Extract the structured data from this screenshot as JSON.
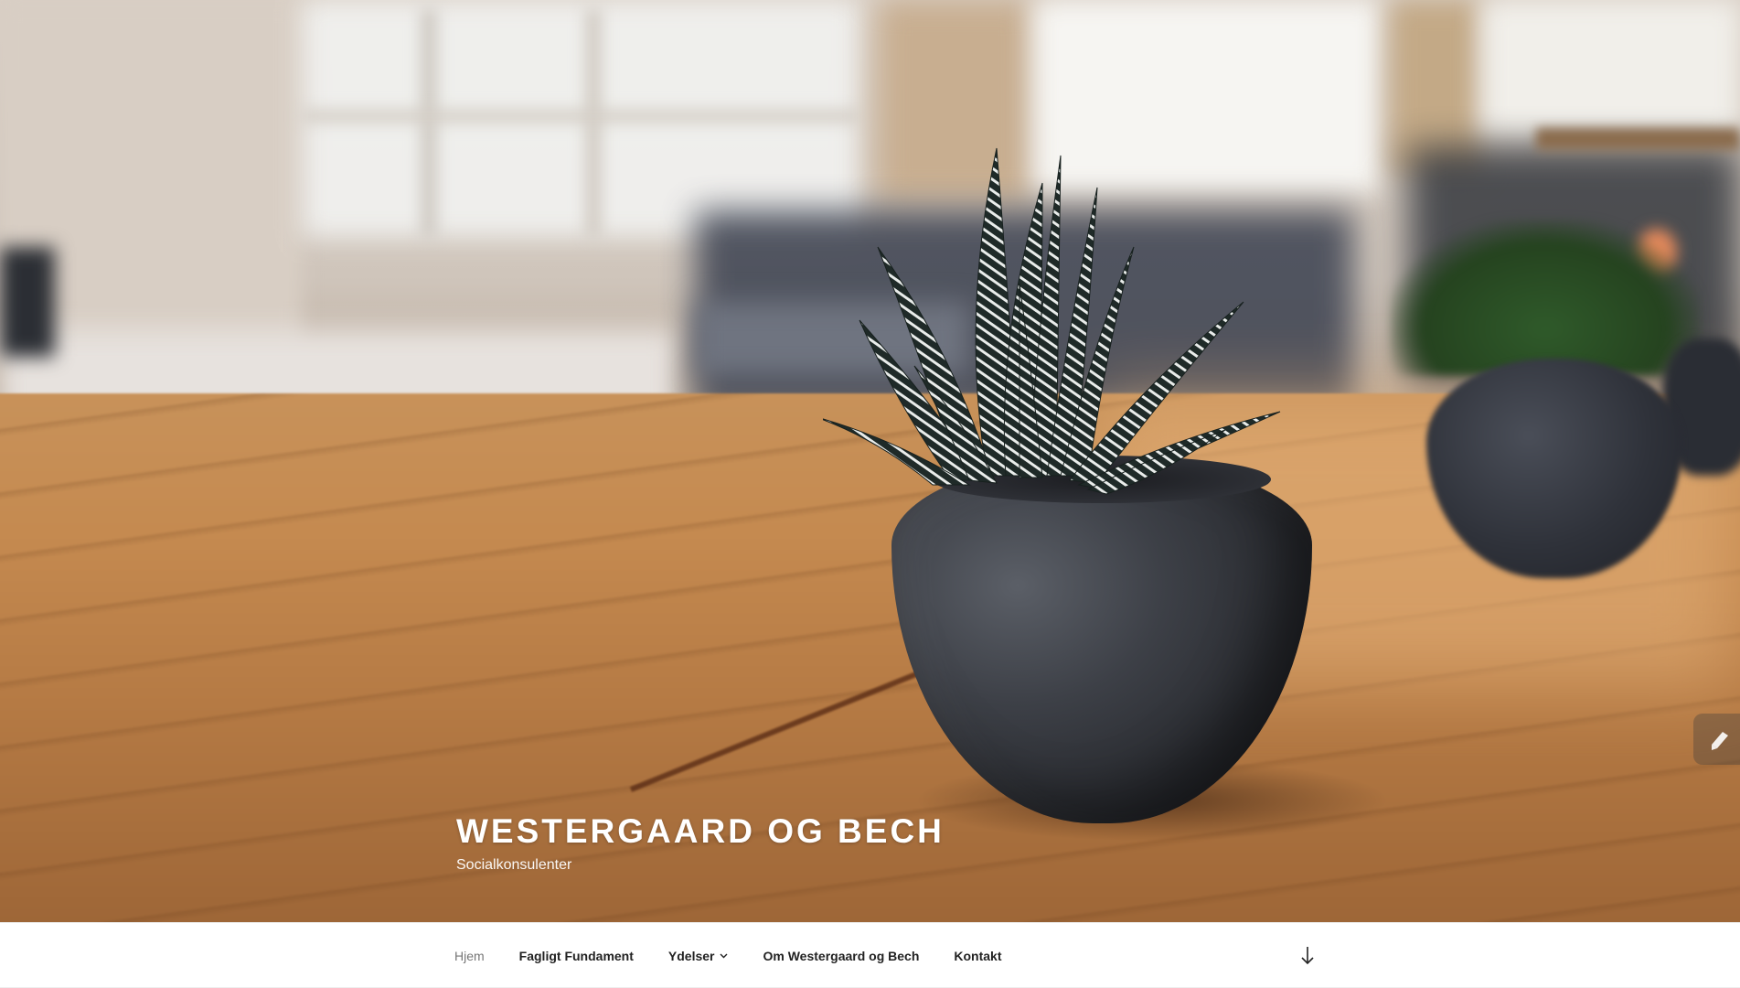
{
  "site": {
    "title": "WESTERGAARD OG BECH",
    "description": "Socialkonsulenter"
  },
  "nav": {
    "items": [
      {
        "label": "Hjem",
        "current": true
      },
      {
        "label": "Fagligt Fundament",
        "current": false
      },
      {
        "label": "Ydelser",
        "current": false,
        "has_submenu": true
      },
      {
        "label": "Om Westergaard og Bech",
        "current": false
      },
      {
        "label": "Kontakt",
        "current": false
      }
    ],
    "scroll_icon": "arrow-down-icon"
  },
  "icons": {
    "submenu": "chevron-down-icon",
    "side_widget": "pencil-icon"
  },
  "colors": {
    "nav_text": "#222222",
    "nav_current": "#767676",
    "title": "#ffffff"
  }
}
